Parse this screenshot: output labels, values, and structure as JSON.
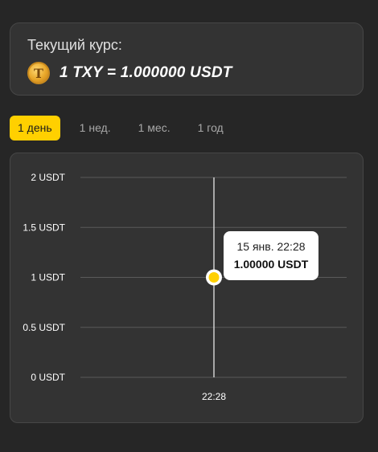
{
  "rate": {
    "title": "Текущий курс:",
    "coin_icon": "coin-t-icon",
    "coin_letter": "T",
    "value": "1 TXY = 1.000000 USDT"
  },
  "periods": [
    {
      "label": "1 день",
      "active": true
    },
    {
      "label": "1 нед.",
      "active": false
    },
    {
      "label": "1 мес.",
      "active": false
    },
    {
      "label": "1 год",
      "active": false
    }
  ],
  "chart_data": {
    "type": "line",
    "y_ticks": [
      "2 USDT",
      "1.5 USDT",
      "1 USDT",
      "0.5 USDT",
      "0 USDT"
    ],
    "y_tick_values": [
      2,
      1.5,
      1,
      0.5,
      0
    ],
    "ylim": [
      0,
      2
    ],
    "x_ticks": [
      "22:28"
    ],
    "series": [
      {
        "points": [
          {
            "x": "22:28",
            "y": 1.0
          }
        ]
      }
    ],
    "grid": true,
    "tooltip": {
      "date": "15 янв. 22:28",
      "value": "1.00000 USDT"
    }
  },
  "colors": {
    "accent": "#ffd000",
    "background": "#262626",
    "card": "#333333"
  }
}
